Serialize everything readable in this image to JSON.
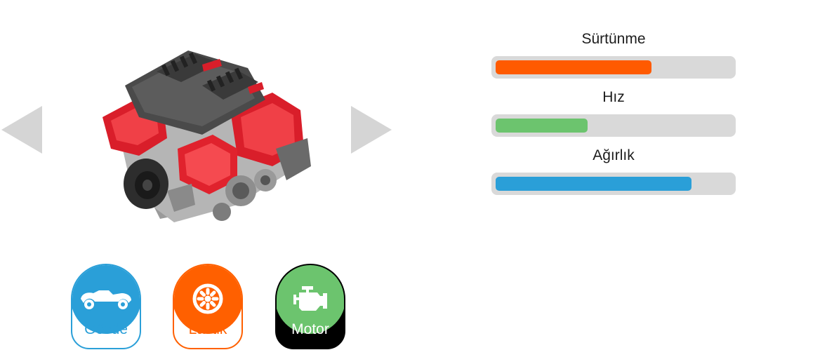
{
  "navigation": {
    "prev_icon": "triangle-left-icon",
    "next_icon": "triangle-right-icon"
  },
  "preview": {
    "icon": "engine-illustration"
  },
  "stats": [
    {
      "label": "Sürtünme",
      "value": 0.66,
      "color": "#ff5a00"
    },
    {
      "label": "Hız",
      "value": 0.39,
      "color": "#6cc46e"
    },
    {
      "label": "Ağırlık",
      "value": 0.83,
      "color": "#2a9fd8"
    }
  ],
  "parts": [
    {
      "label": "Gövde",
      "icon": "car-body-icon",
      "color": "#2a9fd8",
      "selected": false
    },
    {
      "label": "Lastik",
      "icon": "wheel-icon",
      "color": "#ff6000",
      "selected": false
    },
    {
      "label": "Motor",
      "icon": "engine-icon",
      "color": "#6cc46e",
      "selected": true
    }
  ]
}
